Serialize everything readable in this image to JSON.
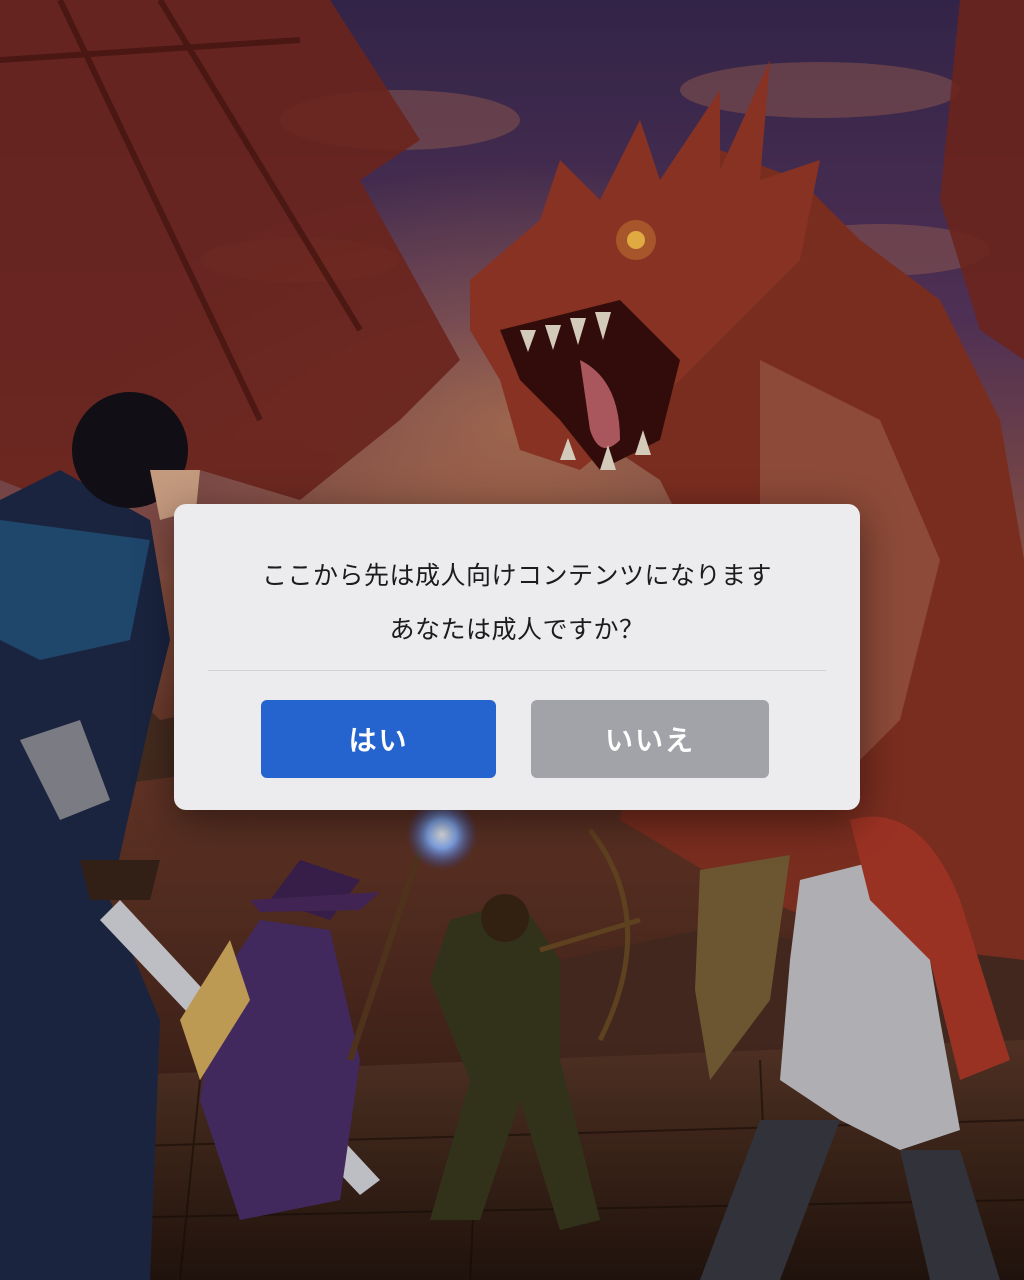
{
  "dialog": {
    "message_line1": "ここから先は成人向けコンテンツになります",
    "message_line2": "あなたは成人ですか？",
    "yes_label": "はい",
    "no_label": "いいえ"
  },
  "colors": {
    "yes_button": "#2563cf",
    "no_button": "#a2a3a8",
    "dialog_background": "#ececee"
  }
}
